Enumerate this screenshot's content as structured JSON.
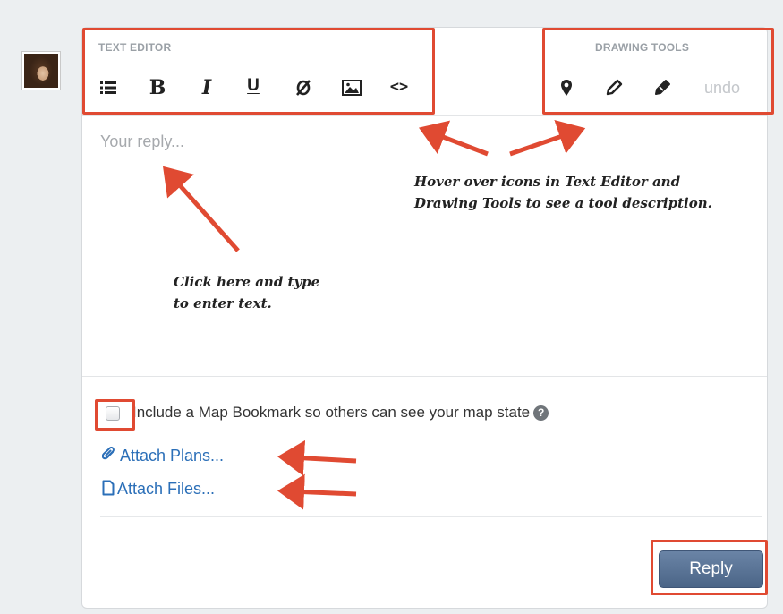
{
  "text_editor": {
    "label": "TEXT EDITOR",
    "tools": [
      {
        "name": "list-icon"
      },
      {
        "name": "bold-icon",
        "glyph": "B"
      },
      {
        "name": "italic-icon",
        "glyph": "I"
      },
      {
        "name": "underline-icon",
        "glyph": "U"
      },
      {
        "name": "link-icon"
      },
      {
        "name": "image-icon"
      },
      {
        "name": "code-icon",
        "glyph": "<>"
      }
    ]
  },
  "drawing_tools": {
    "label": "DRAWING TOOLS",
    "tools": [
      {
        "name": "map-pin-icon"
      },
      {
        "name": "pencil-icon"
      },
      {
        "name": "marker-icon"
      }
    ],
    "undo_label": "undo"
  },
  "reply": {
    "placeholder": "Your reply..."
  },
  "annotations": {
    "hover_line1": "Hover over icons in Text Editor and",
    "hover_line2": "Drawing Tools to see a tool description.",
    "click_line1": "Click here and type",
    "click_line2": "to enter text."
  },
  "bookmark": {
    "label": "Include a Map Bookmark so others can see your map state",
    "help_glyph": "?"
  },
  "attachments": {
    "plans_label": "Attach Plans...",
    "files_label": "Attach Files..."
  },
  "actions": {
    "reply_label": "Reply"
  },
  "colors": {
    "annotation_red": "#e04a32",
    "link_blue": "#2b6fb8",
    "button_blue": "#5a7497"
  }
}
